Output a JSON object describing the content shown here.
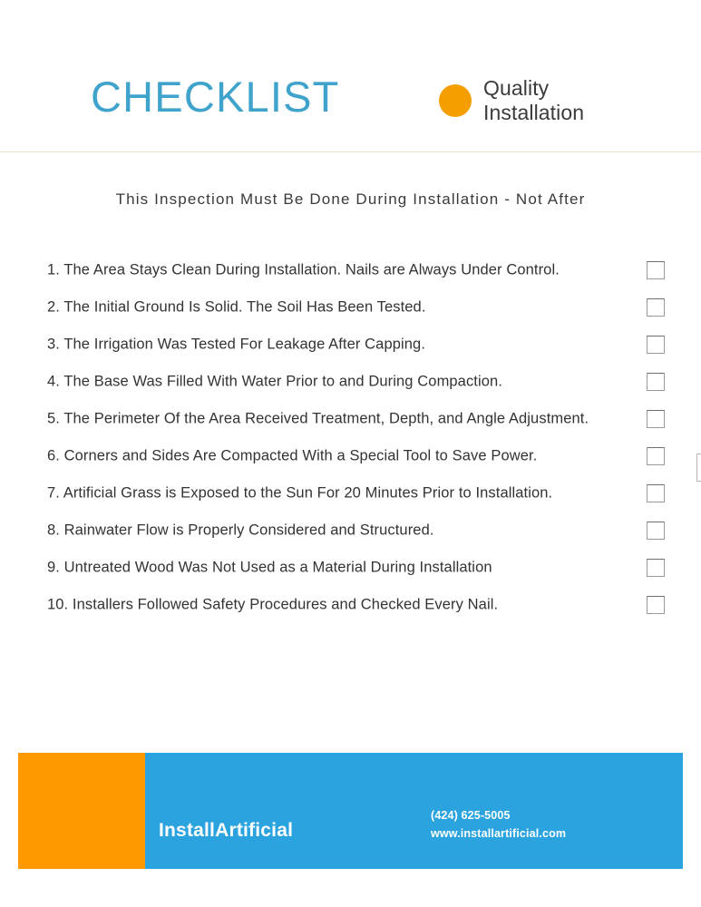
{
  "header": {
    "title": "CHECKLIST",
    "title_color": "#3FA3CC",
    "brand": {
      "dot_color": "#F59E00",
      "line1": "Quality",
      "line2": "Installation"
    }
  },
  "inspection_note": "This Inspection Must Be Done During Installation - Not After",
  "checklist": {
    "items": [
      {
        "text": "1. The Area Stays Clean During Installation. Nails are Always Under Control.",
        "checked": false
      },
      {
        "text": "2. The Initial Ground Is Solid. The Soil Has Been Tested.",
        "checked": false
      },
      {
        "text": "3. The Irrigation Was Tested For Leakage After Capping.",
        "checked": false
      },
      {
        "text": "4. The Base Was Filled With Water Prior to and During Compaction.",
        "checked": false
      },
      {
        "text": "5. The Perimeter Of the Area Received Treatment, Depth, and Angle Adjustment.",
        "checked": false
      },
      {
        "text": "6. Corners and Sides Are Compacted With a Special Tool to Save Power.",
        "checked": false
      },
      {
        "text": "7. Artificial Grass is Exposed to the Sun For 20 Minutes Prior to Installation.",
        "checked": false
      },
      {
        "text": "8. Rainwater Flow is Properly Considered and Structured.",
        "checked": false
      },
      {
        "text": "9. Untreated Wood Was Not Used as a Material During Installation",
        "checked": false
      },
      {
        "text": "10. Installers Followed Safety Procedures and Checked Every Nail.",
        "checked": false
      }
    ]
  },
  "footer": {
    "orange_color": "#FF9900",
    "blue_color": "#2AA3DE",
    "company": "InstallArtificial",
    "phone": "(424) 625-5005",
    "website": "www.installartificial.com"
  }
}
